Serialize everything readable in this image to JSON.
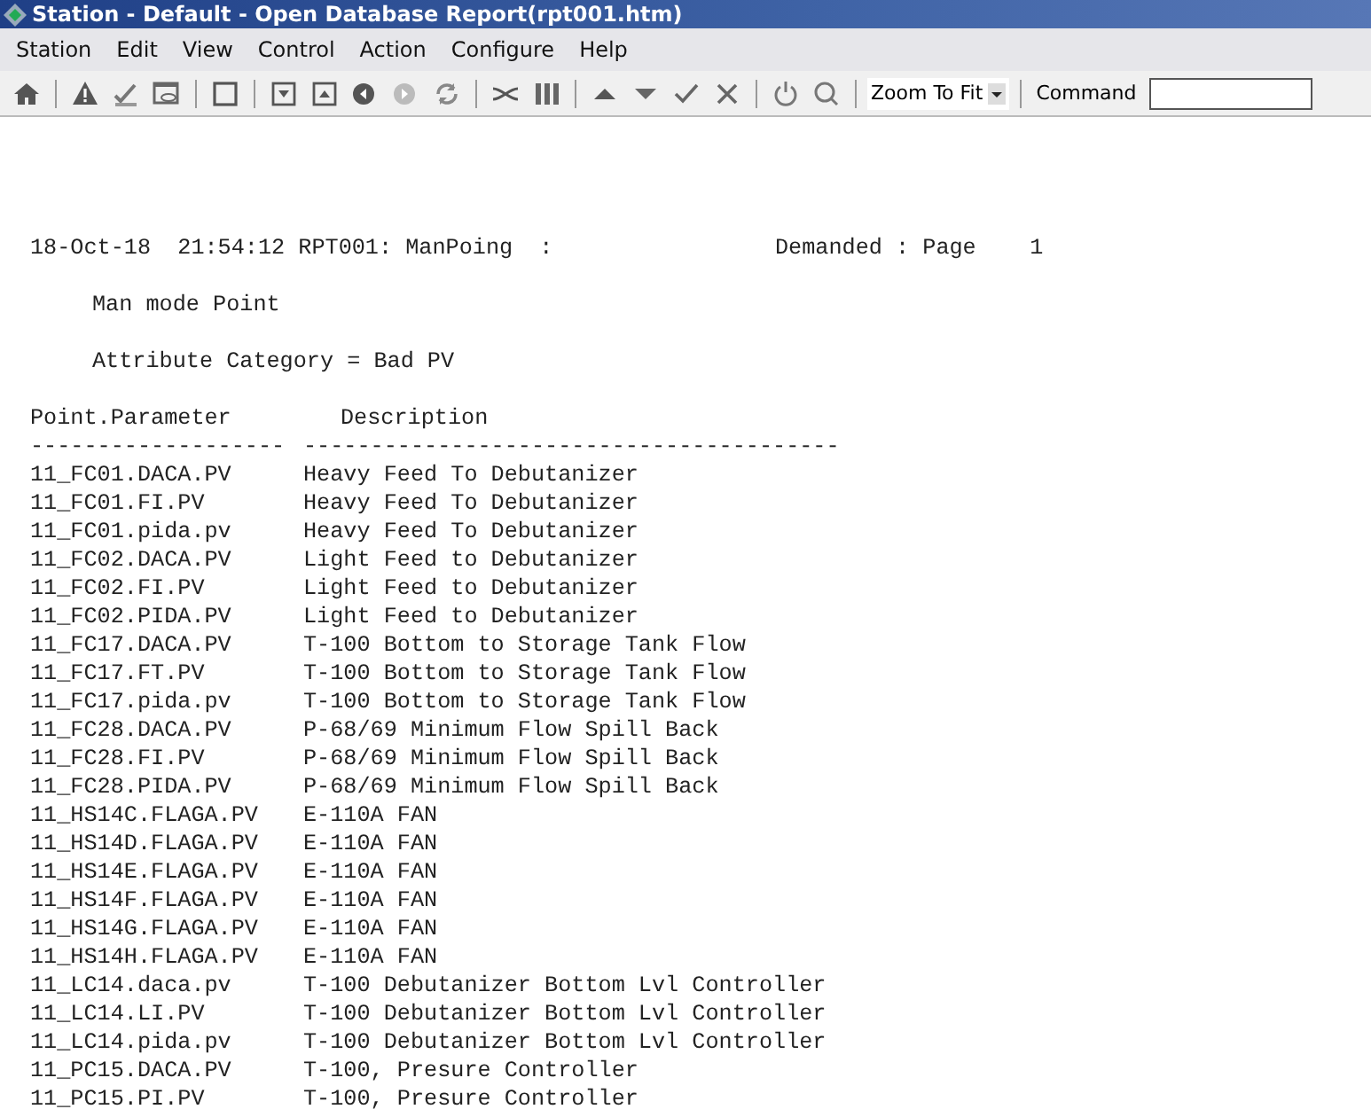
{
  "window": {
    "title": "Station - Default - Open Database Report(rpt001.htm)"
  },
  "menu": [
    "Station",
    "Edit",
    "View",
    "Control",
    "Action",
    "Configure",
    "Help"
  ],
  "toolbar": {
    "zoom": "Zoom To Fit",
    "command_label": "Command"
  },
  "report": {
    "header_left": "18-Oct-18  21:54:12 RPT001: ManPoing  :",
    "header_right": "Demanded : Page    1",
    "subtitle": "Man mode Point",
    "category": "Attribute Category = Bad PV",
    "columns": [
      "Point.Parameter",
      "Description"
    ],
    "rules": [
      "-------------------",
      "----------------------------------------"
    ],
    "rows": [
      {
        "point": "11_FC01.DACA.PV",
        "description": "Heavy Feed To Debutanizer"
      },
      {
        "point": "11_FC01.FI.PV",
        "description": "Heavy Feed To Debutanizer"
      },
      {
        "point": "11_FC01.pida.pv",
        "description": "Heavy Feed To Debutanizer"
      },
      {
        "point": "11_FC02.DACA.PV",
        "description": "Light Feed to Debutanizer"
      },
      {
        "point": "11_FC02.FI.PV",
        "description": "Light Feed to Debutanizer"
      },
      {
        "point": "11_FC02.PIDA.PV",
        "description": "Light Feed to Debutanizer"
      },
      {
        "point": "11_FC17.DACA.PV",
        "description": "T-100 Bottom to Storage Tank Flow"
      },
      {
        "point": "11_FC17.FT.PV",
        "description": "T-100 Bottom to Storage Tank Flow"
      },
      {
        "point": "11_FC17.pida.pv",
        "description": "T-100 Bottom to Storage Tank Flow"
      },
      {
        "point": "11_FC28.DACA.PV",
        "description": "P-68/69 Minimum Flow Spill Back"
      },
      {
        "point": "11_FC28.FI.PV",
        "description": "P-68/69 Minimum Flow Spill Back"
      },
      {
        "point": "11_FC28.PIDA.PV",
        "description": "P-68/69 Minimum Flow Spill Back"
      },
      {
        "point": "11_HS14C.FLAGA.PV",
        "description": "E-110A FAN"
      },
      {
        "point": "11_HS14D.FLAGA.PV",
        "description": "E-110A FAN"
      },
      {
        "point": "11_HS14E.FLAGA.PV",
        "description": "E-110A FAN"
      },
      {
        "point": "11_HS14F.FLAGA.PV",
        "description": "E-110A FAN"
      },
      {
        "point": "11_HS14G.FLAGA.PV",
        "description": "E-110A FAN"
      },
      {
        "point": "11_HS14H.FLAGA.PV",
        "description": "E-110A FAN"
      },
      {
        "point": "11_LC14.daca.pv",
        "description": "T-100 Debutanizer Bottom Lvl Controller"
      },
      {
        "point": "11_LC14.LI.PV",
        "description": "T-100 Debutanizer Bottom Lvl Controller"
      },
      {
        "point": "11_LC14.pida.pv",
        "description": "T-100 Debutanizer Bottom Lvl Controller"
      },
      {
        "point": "11_PC15.DACA.PV",
        "description": "T-100, Presure Controller"
      },
      {
        "point": "11_PC15.PI.PV",
        "description": "T-100, Presure Controller"
      }
    ]
  }
}
